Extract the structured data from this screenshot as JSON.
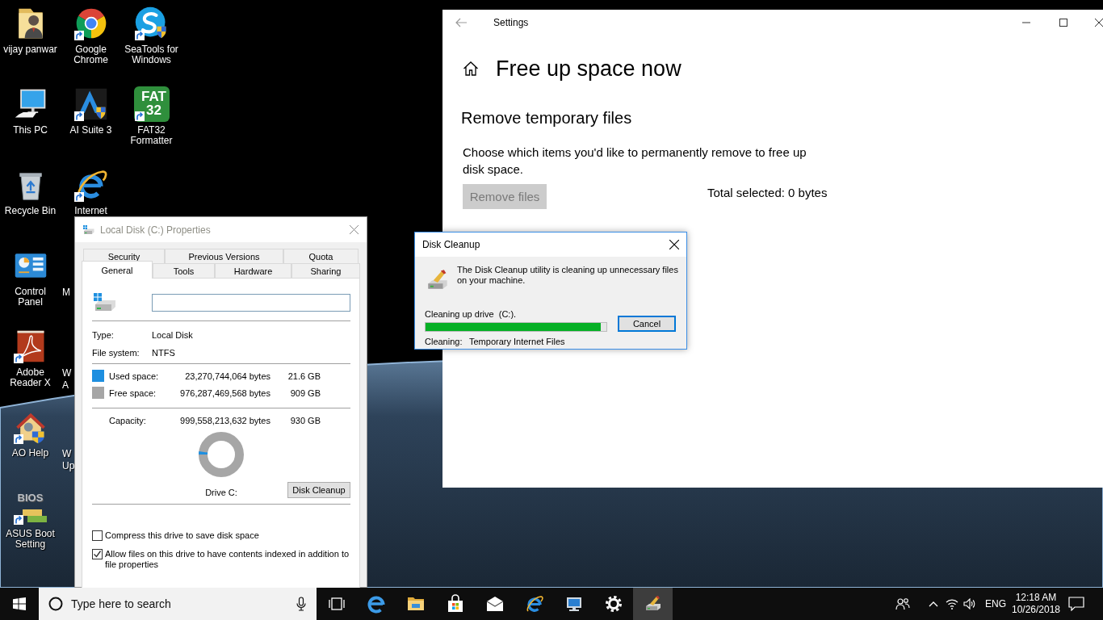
{
  "desktop": {
    "columns": [
      {
        "icons": [
          {
            "kind": "full",
            "label": "vijay panwar",
            "shortcut": false
          },
          {
            "kind": "full",
            "label": "This PC",
            "shortcut": false
          },
          {
            "kind": "full",
            "label": "Recycle Bin",
            "shortcut": false
          },
          {
            "kind": "full",
            "label": "Control Panel",
            "shortcut": false
          },
          {
            "kind": "full",
            "label": "Adobe Reader X",
            "shortcut": true
          },
          {
            "kind": "full",
            "label": "AO Help",
            "shortcut": true
          },
          {
            "kind": "full",
            "label": "ASUS Boot Setting",
            "shortcut": true,
            "logo_text": "BIOS"
          }
        ]
      },
      {
        "icons": [
          {
            "kind": "full",
            "label": "Google Chrome",
            "shortcut": true
          },
          {
            "kind": "full",
            "label": "AI Suite 3",
            "shortcut": true
          },
          {
            "kind": "full",
            "label": "Internet",
            "shortcut": true
          },
          {
            "kind": "covered",
            "label": "M"
          },
          {
            "kind": "covered",
            "label": "W A"
          },
          {
            "kind": "covered",
            "label": "W Up"
          }
        ]
      },
      {
        "icons": [
          {
            "kind": "full",
            "label": "SeaTools for Windows",
            "shortcut": true
          },
          {
            "kind": "full",
            "label": "FAT32 Formatter",
            "shortcut": true,
            "logo_text": "FAT 32"
          }
        ]
      }
    ]
  },
  "settings_window": {
    "title": "Settings",
    "heading": "Free up space now",
    "section": "Remove temporary files",
    "description": "Choose which items you'd like to permanently remove to free up disk space.",
    "remove_button": {
      "label": "Remove files",
      "disabled": true
    },
    "total": "Total selected: 0 bytes"
  },
  "properties_dialog": {
    "title": "Local Disk (C:) Properties",
    "active": false,
    "tabs_back": [
      {
        "label": "Security",
        "selected": false
      },
      {
        "label": "Previous Versions",
        "selected": false
      },
      {
        "label": "Quota",
        "selected": false
      }
    ],
    "tabs_front": [
      {
        "label": "General",
        "selected": true
      },
      {
        "label": "Tools",
        "selected": false
      },
      {
        "label": "Hardware",
        "selected": false
      },
      {
        "label": "Sharing",
        "selected": false
      }
    ],
    "info": [
      {
        "label": "Type:",
        "value": "Local Disk"
      },
      {
        "label": "File system:",
        "value": "NTFS"
      }
    ],
    "space": [
      {
        "label": "Used space:",
        "bytes": "23,270,744,064 bytes",
        "size": "21.6 GB",
        "color": "#1e8fe0"
      },
      {
        "label": "Free space:",
        "bytes": "976,287,469,568 bytes",
        "size": "909 GB",
        "color": "#a6a6a6"
      }
    ],
    "capacity": {
      "label": "Capacity:",
      "bytes": "999,558,213,632 bytes",
      "size": "930 GB"
    },
    "drive_chart": {
      "label": "Drive C:",
      "level": 0.023
    },
    "cleanup_button": "Disk Cleanup",
    "options": [
      {
        "label": "Compress this drive to save disk space",
        "checked": false
      },
      {
        "label": "Allow files on this drive to have contents indexed in addition to file properties",
        "checked": true
      }
    ]
  },
  "cleanup_dialog": {
    "title": "Disk Cleanup",
    "active": true,
    "message": "The Disk Cleanup utility is cleaning up unnecessary files on your machine.",
    "status": "Cleaning up drive  (C:).",
    "progress": {
      "level": 0.97
    },
    "cancel_button": "Cancel",
    "current_label": "Cleaning:",
    "current_value": "Temporary Internet Files"
  },
  "taskbar": {
    "search_placeholder": "Type here to search",
    "apps": [
      {
        "active": false
      },
      {
        "active": false
      },
      {
        "active": false
      },
      {
        "active": false
      },
      {
        "active": false
      },
      {
        "active": false
      },
      {
        "active": false
      },
      {
        "active": true
      }
    ],
    "language": "ENG",
    "time": "12:18 AM",
    "date": "10/26/2018"
  }
}
